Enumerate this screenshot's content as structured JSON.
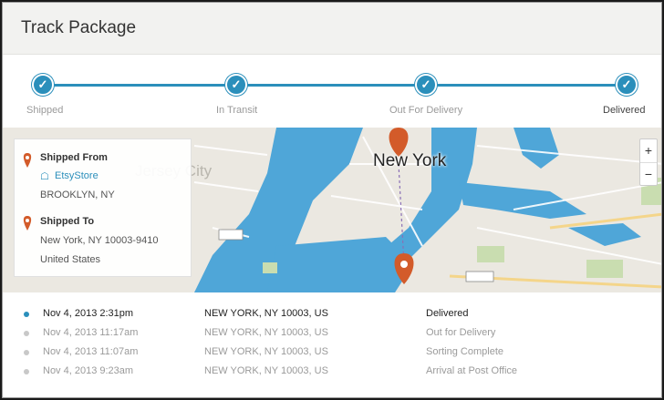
{
  "header": {
    "title": "Track Package"
  },
  "progress": {
    "accent": "#2b8fbb",
    "steps": [
      {
        "label": "Shipped",
        "complete": true
      },
      {
        "label": "In Transit",
        "complete": true
      },
      {
        "label": "Out For Delivery",
        "complete": true
      },
      {
        "label": "Delivered",
        "complete": true,
        "current": true
      }
    ]
  },
  "map": {
    "city_main": "New York",
    "city_faded": "Jersey City",
    "zoom_in": "+",
    "zoom_out": "−",
    "pin_color": "#d35b2a",
    "water_color": "#4fa6d8"
  },
  "shipment": {
    "from_label": "Shipped From",
    "from_store": "EtsyStore",
    "from_city": "BROOKLYN, NY",
    "to_label": "Shipped To",
    "to_line1": "New York, NY 10003-9410",
    "to_line2": "United States"
  },
  "events": [
    {
      "date": "Nov 4, 2013 2:31pm",
      "location": "NEW YORK, NY 10003, US",
      "status": "Delivered",
      "current": true
    },
    {
      "date": "Nov 4, 2013 11:17am",
      "location": "NEW YORK, NY 10003, US",
      "status": "Out for Delivery",
      "current": false
    },
    {
      "date": "Nov 4, 2013 11:07am",
      "location": "NEW YORK, NY 10003, US",
      "status": "Sorting Complete",
      "current": false
    },
    {
      "date": "Nov 4, 2013 9:23am",
      "location": "NEW YORK, NY 10003, US",
      "status": "Arrival at Post Office",
      "current": false
    }
  ]
}
